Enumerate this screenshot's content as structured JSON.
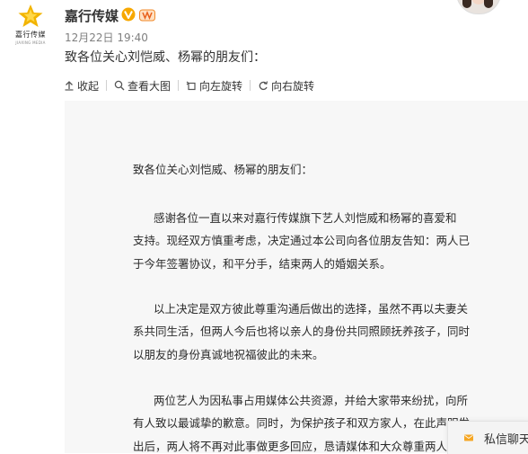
{
  "author": {
    "name": "嘉行传媒",
    "avatar_text": "嘉行传媒",
    "avatar_sub": "JIAXING MEDIA"
  },
  "post": {
    "time": "12月22日 19:40",
    "text": "致各位关心刘恺威、杨幂的朋友们："
  },
  "toolbar": {
    "collapse": "收起",
    "view_large": "查看大图",
    "rotate_left": "向左旋转",
    "rotate_right": "向右旋转"
  },
  "document": {
    "greeting": "致各位关心刘恺威、杨幂的朋友们：",
    "lines": [
      "感谢各位一直以来对嘉行传媒旗下艺人刘恺威和杨幂的喜爱和",
      "支持。现经双方慎重考虑，决定通过本公司向各位朋友告知：两人已",
      "于今年签署协议，和平分手，结束两人的婚姻关系。",
      "以上决定是双方彼此尊重沟通后做出的选择，虽然不再以夫妻关",
      "系共同生活，但两人今后也将以亲人的身份共同照顾抚养孩子，同时",
      "以朋友的身份真诚地祝福彼此的未来。",
      "两位艺人为因私事占用媒体公共资源，并给大家带来纷扰，向所",
      "有人致以最诚挚的歉意。同时，为保护孩子和双方家人，在此声明发",
      "出后，两人将不再对此事做更多回应，恳请媒体和大众尊重两人的想"
    ]
  },
  "dm": {
    "label": "私信聊天"
  },
  "colors": {
    "accent": "#f7a800",
    "verified": "#f7a800",
    "mail": "#f5a623"
  }
}
